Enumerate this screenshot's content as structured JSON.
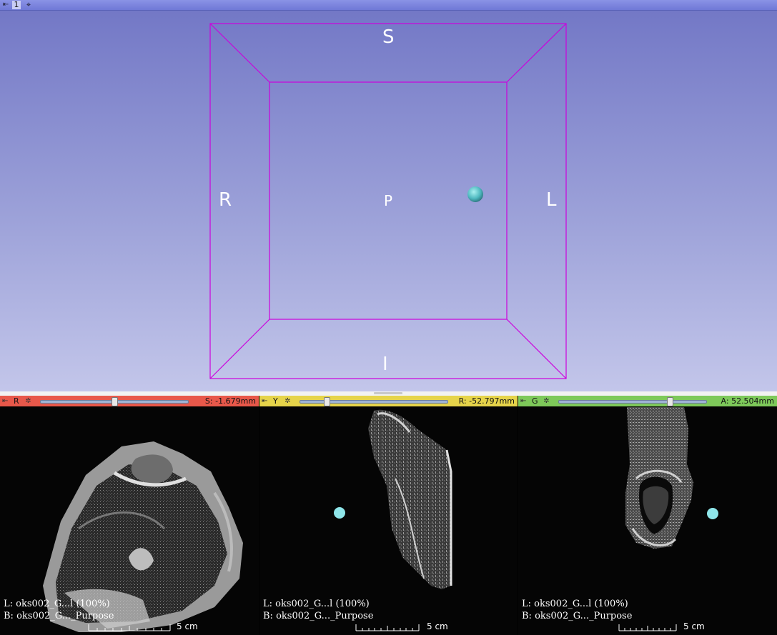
{
  "view3d": {
    "layout_number": "1",
    "orientation": {
      "superior": "S",
      "inferior": "I",
      "right": "R",
      "left": "L",
      "posterior": "P"
    },
    "box_color": "#cc00dd",
    "background_top": "#7378c6",
    "background_bottom": "#c3c6ea",
    "fiducial_color": "#4fb9c0"
  },
  "slices": [
    {
      "letter": "R",
      "bar_color": "#e8584a",
      "offset": "S: -1.679mm",
      "slider_fraction": 0.5,
      "label_L": "L: oks002_G...l (100%)",
      "label_B": "B: oks002_G..._Purpose",
      "ruler": "5 cm"
    },
    {
      "letter": "Y",
      "bar_color": "#e6d44a",
      "offset": "R: -52.797mm",
      "slider_fraction": 0.18,
      "label_L": "L: oks002_G...l (100%)",
      "label_B": "B: oks002_G..._Purpose",
      "ruler": "5 cm"
    },
    {
      "letter": "G",
      "bar_color": "#7ec95a",
      "offset": "A: 52.504mm",
      "slider_fraction": 0.75,
      "label_L": "L: oks002_G...l (100%)",
      "label_B": "B: oks002_G..._Purpose",
      "ruler": "5 cm"
    }
  ],
  "icons": {
    "pin": "pin-icon",
    "link": "link-icon",
    "crosshair": "crosshair-icon"
  }
}
